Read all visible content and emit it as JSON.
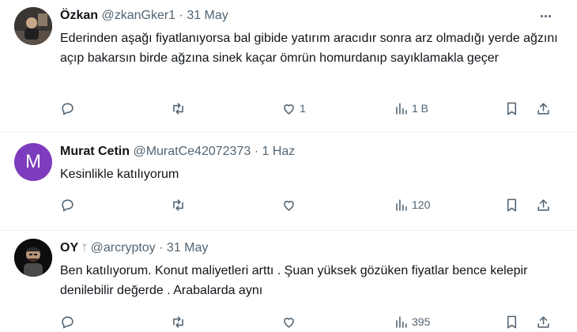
{
  "tweets": [
    {
      "name": "Özkan",
      "handle": "@zkanGker1",
      "separator": "·",
      "date": "31 May",
      "text": "Ederinden aşağı fiyatlanıyorsa bal gibide yatırım aracıdır sonra arz olmadığı yerde ağzını açıp bakarsın birde ağzına sinek kaçar ömrün homurdanıp sayıklamakla geçer",
      "likes": "1",
      "views": "1 B",
      "avatar_icon": "profile-photo"
    },
    {
      "name": "Murat Cetin",
      "handle": "@MuratCe42072373",
      "separator": "·",
      "date": "1 Haz",
      "text": "Kesinlikle katılıyorum",
      "likes": "",
      "views": "120",
      "avatar_letter": "M",
      "avatar_color": "#7d3bbd"
    },
    {
      "name": "OY",
      "badge": "ᛉ",
      "handle": "@arcryptoy",
      "separator": "·",
      "date": "31 May",
      "text": "Ben katılıyorum. Konut maliyetleri arttı . Şuan yüksek gözüken fiyatlar bence kelepir denilebilir değerde . Arabalarda aynı",
      "likes": "",
      "views": "395",
      "avatar_icon": "profile-photo"
    }
  ],
  "icons": [
    "reply-icon",
    "retweet-icon",
    "like-icon",
    "views-icon",
    "bookmark-icon",
    "share-icon",
    "more-icon"
  ],
  "colors": {
    "text": "#0f1419",
    "muted": "#536471",
    "divider": "#eff3f4",
    "avatar_m": "#7d3bbd"
  }
}
